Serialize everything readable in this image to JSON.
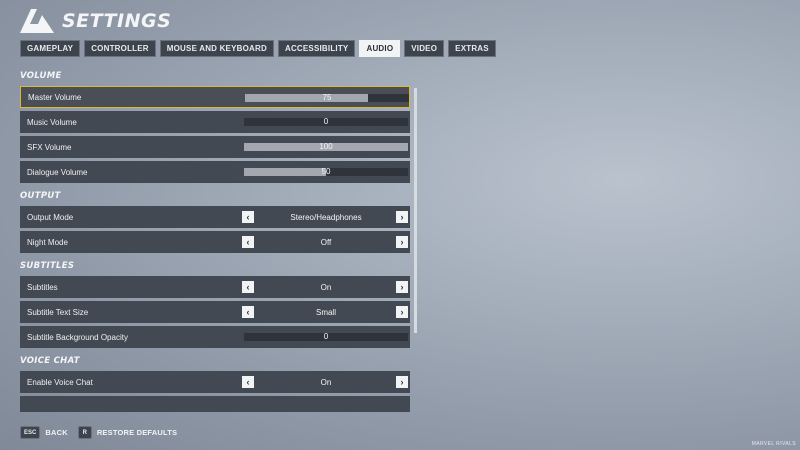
{
  "header": {
    "title": "SETTINGS",
    "logo_icon": "marvel-rivals-logo-icon"
  },
  "tabs": [
    {
      "label": "GAMEPLAY",
      "active": false
    },
    {
      "label": "CONTROLLER",
      "active": false
    },
    {
      "label": "MOUSE AND KEYBOARD",
      "active": false
    },
    {
      "label": "ACCESSIBILITY",
      "active": false
    },
    {
      "label": "AUDIO",
      "active": true
    },
    {
      "label": "VIDEO",
      "active": false
    },
    {
      "label": "EXTRAS",
      "active": false
    }
  ],
  "sections": {
    "volume": {
      "title": "VOLUME",
      "rows": [
        {
          "label": "Master Volume",
          "value": "75",
          "level": 0.75
        },
        {
          "label": "Music Volume",
          "value": "0",
          "level": 0
        },
        {
          "label": "SFX Volume",
          "value": "100",
          "level": 1.0
        },
        {
          "label": "Dialogue Volume",
          "value": "50",
          "level": 0.5
        }
      ]
    },
    "output": {
      "title": "OUTPUT",
      "rows": [
        {
          "label": "Output Mode",
          "value": "Stereo/Headphones"
        },
        {
          "label": "Night Mode",
          "value": "Off"
        }
      ]
    },
    "subtitles": {
      "title": "SUBTITLES",
      "rows": [
        {
          "label": "Subtitles",
          "value": "On"
        },
        {
          "label": "Subtitle Text Size",
          "value": "Small"
        },
        {
          "label": "Subtitle Background Opacity",
          "value": "0",
          "level": 0
        }
      ]
    },
    "voice_chat": {
      "title": "VOICE CHAT",
      "rows": [
        {
          "label": "Enable Voice Chat",
          "value": "On"
        }
      ]
    }
  },
  "footer": {
    "back": {
      "key": "ESC",
      "label": "BACK"
    },
    "restore": {
      "key": "R",
      "label": "RESTORE DEFAULTS"
    }
  },
  "watermark": "MARVEL RIVALS",
  "colors": {
    "selected_border": "#e0b732",
    "row_bg": "#434952",
    "active_tab_bg": "#f2f3f5"
  }
}
